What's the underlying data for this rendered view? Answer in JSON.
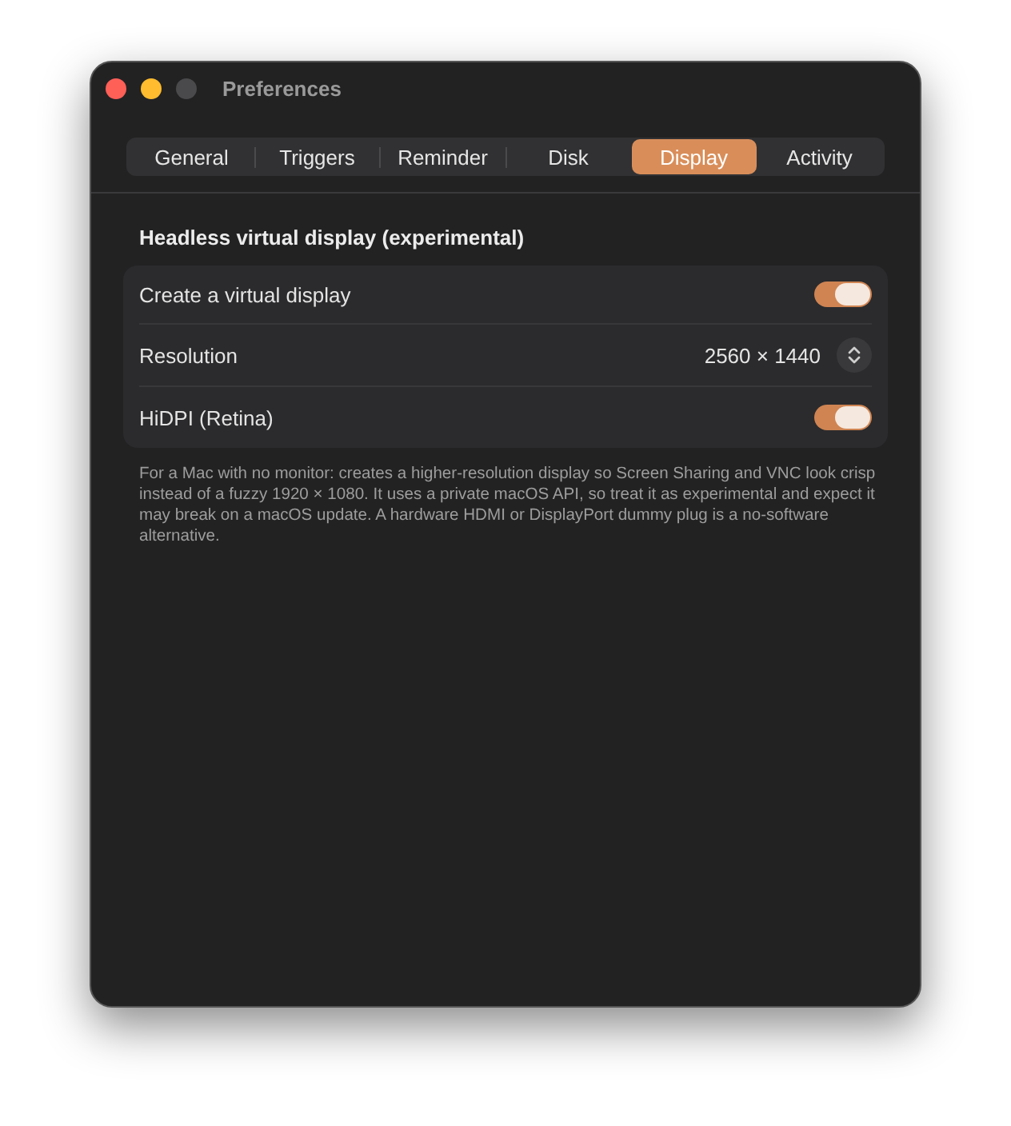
{
  "window": {
    "title": "Preferences"
  },
  "tabs": [
    {
      "label": "General",
      "selected": false
    },
    {
      "label": "Triggers",
      "selected": false
    },
    {
      "label": "Reminder",
      "selected": false
    },
    {
      "label": "Disk",
      "selected": false
    },
    {
      "label": "Display",
      "selected": true
    },
    {
      "label": "Activity",
      "selected": false
    }
  ],
  "section": {
    "title": "Headless virtual display (experimental)",
    "rows": [
      {
        "kind": "toggle",
        "label": "Create a virtual display",
        "on": true
      },
      {
        "kind": "stepper",
        "label": "Resolution",
        "value": "2560 × 1440"
      },
      {
        "kind": "toggle",
        "label": "HiDPI (Retina)",
        "on": true
      }
    ],
    "note": "For a Mac with no monitor: creates a higher-resolution display so Screen Sharing and VNC look crisp instead of a fuzzy 1920 × 1080. It uses a private macOS API, so treat it as experimental and expect it may break on a macOS update. A hardware HDMI or DisplayPort dummy plug is a no-software alternative."
  }
}
